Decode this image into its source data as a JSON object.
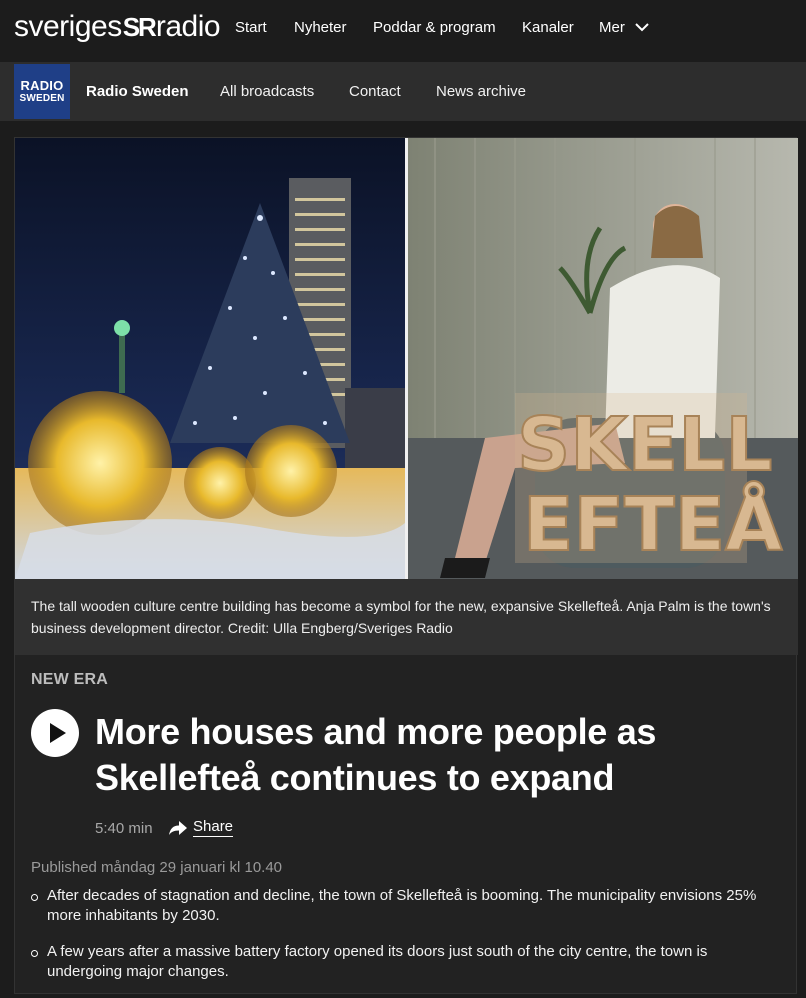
{
  "top_nav": {
    "logo_text_1": "sveriges",
    "logo_mark": "SR",
    "logo_text_2": "radio",
    "items": [
      "Start",
      "Nyheter",
      "Poddar & program",
      "Kanaler",
      "Mer"
    ],
    "more_icon": "chevron-down-icon"
  },
  "sub_nav": {
    "badge_line1": "RADIO",
    "badge_line2": "SWEDEN",
    "badge_color": "#1f3f87",
    "title": "Radio Sweden",
    "links": [
      "All broadcasts",
      "Contact",
      "News archive"
    ]
  },
  "article": {
    "image_caption": "The tall wooden culture centre building has become a symbol for the new, expansive Skellefteå. Anja Palm is the town's business development director. Credit: Ulla Engberg/Sveriges Radio",
    "sign_text_line1": "SKELL",
    "sign_text_line2": "EFTEÅ",
    "kicker": "NEW ERA",
    "headline": "More houses and more people as Skellefteå continues to expand",
    "duration": "5:40 min",
    "share_label": "Share",
    "published": "Published måndag 29 januari kl 10.40",
    "bullets": [
      "After decades of stagnation and decline, the town of Skellefteå is booming. The municipality envisions 25% more inhabitants by 2030.",
      "A few years after a massive battery factory opened its doors just south of the city centre, the town is undergoing major changes."
    ]
  }
}
